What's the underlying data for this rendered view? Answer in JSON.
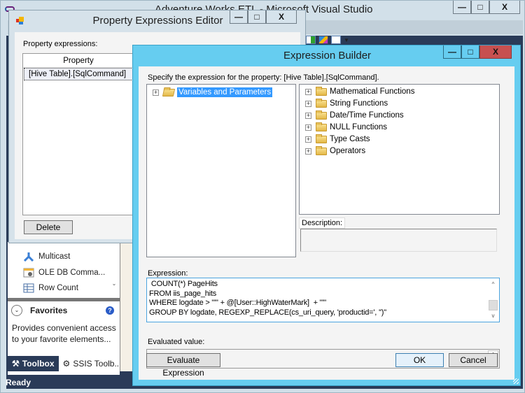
{
  "vs": {
    "title": "Adventure Works ETL - Microsoft Visual Studio",
    "caption": {
      "minimize": "—",
      "maximize": "□",
      "close": "X"
    },
    "status": "Ready",
    "toolbox": {
      "items": [
        {
          "label": "Multicast",
          "icon": "multicast-icon"
        },
        {
          "label": "OLE DB Comma...",
          "icon": "ole-db-command-icon"
        },
        {
          "label": "Row Count",
          "icon": "row-count-icon"
        }
      ],
      "scroll_down": "⌄",
      "favorites": {
        "expander": "⌄",
        "title": "Favorites",
        "help": "?",
        "description": "Provides convenient access to your favorite elements..."
      },
      "tabs": [
        {
          "label": "Toolbox",
          "icon": "toolbox-icon",
          "active": true
        },
        {
          "label": "SSIS Toolb...",
          "icon": "ssis-toolbox-icon",
          "active": false
        }
      ]
    }
  },
  "property_editor": {
    "title": "Property Expressions Editor",
    "caption": {
      "minimize": "—",
      "maximize": "□",
      "close": "X"
    },
    "label": "Property expressions:",
    "grid": {
      "column": "Property",
      "rows": [
        "[Hive Table].[SqlCommand]"
      ]
    },
    "delete_label": "Delete"
  },
  "expression_builder": {
    "title": "Expression Builder",
    "caption": {
      "minimize": "—",
      "maximize": "□",
      "close": "X"
    },
    "prompt": "Specify the expression for the property: [Hive Table].[SqlCommand].",
    "variables_tree": {
      "nodes": [
        {
          "label": "Variables and Parameters",
          "selected": true
        }
      ]
    },
    "functions_tree": {
      "nodes": [
        {
          "label": "Mathematical Functions"
        },
        {
          "label": "String Functions"
        },
        {
          "label": "Date/Time Functions"
        },
        {
          "label": "NULL Functions"
        },
        {
          "label": "Type Casts"
        },
        {
          "label": "Operators"
        }
      ]
    },
    "description_label": "Description:",
    "description_value": "",
    "expression_label": "Expression:",
    "expression_value": " COUNT(*) PageHits\nFROM iis_page_hits\nWHERE logdate > \"'\" + @[User::HighWaterMark]  + \"'\"\nGROUP BY logdate, REGEXP_REPLACE(cs_uri_query, 'productid=', '')\"",
    "evaluated_label": "Evaluated value:",
    "evaluated_value": "",
    "scroll_up": "^",
    "scroll_down": "v",
    "buttons": {
      "evaluate": "Evaluate Expression",
      "ok": "OK",
      "cancel": "Cancel"
    }
  }
}
